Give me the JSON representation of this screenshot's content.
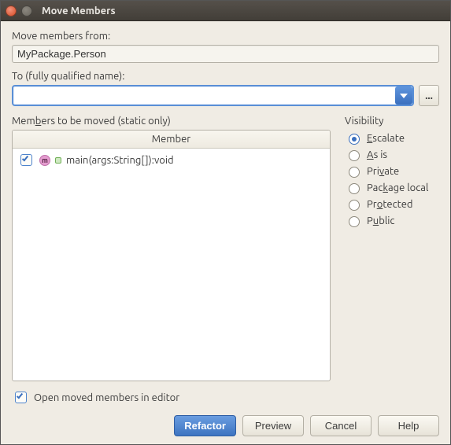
{
  "window": {
    "title": "Move Members"
  },
  "form": {
    "from_label": "Move members from:",
    "from_value": "MyPackage.Person",
    "to_label": "To (fully qualified name):",
    "to_value": "",
    "browse_label": "..."
  },
  "members": {
    "section_label": "Members to be moved (static only)",
    "column_header": "Member",
    "items": [
      {
        "checked": true,
        "signature": "main(args:String[]):void"
      }
    ]
  },
  "visibility": {
    "label": "Visibility",
    "options": [
      {
        "key": "escalate",
        "label": "Escalate",
        "accel": "E"
      },
      {
        "key": "asis",
        "label": "As is",
        "accel": "A"
      },
      {
        "key": "private",
        "label": "Private",
        "accel": "v"
      },
      {
        "key": "package",
        "label": "Package local",
        "accel": "k"
      },
      {
        "key": "protected",
        "label": "Protected",
        "accel": "o"
      },
      {
        "key": "public",
        "label": "Public",
        "accel": "u"
      }
    ],
    "selected": "escalate"
  },
  "footer": {
    "open_moved_label": "Open moved members in editor",
    "open_moved_checked": true
  },
  "buttons": {
    "refactor": "Refactor",
    "preview": "Preview",
    "cancel": "Cancel",
    "help": "Help"
  }
}
